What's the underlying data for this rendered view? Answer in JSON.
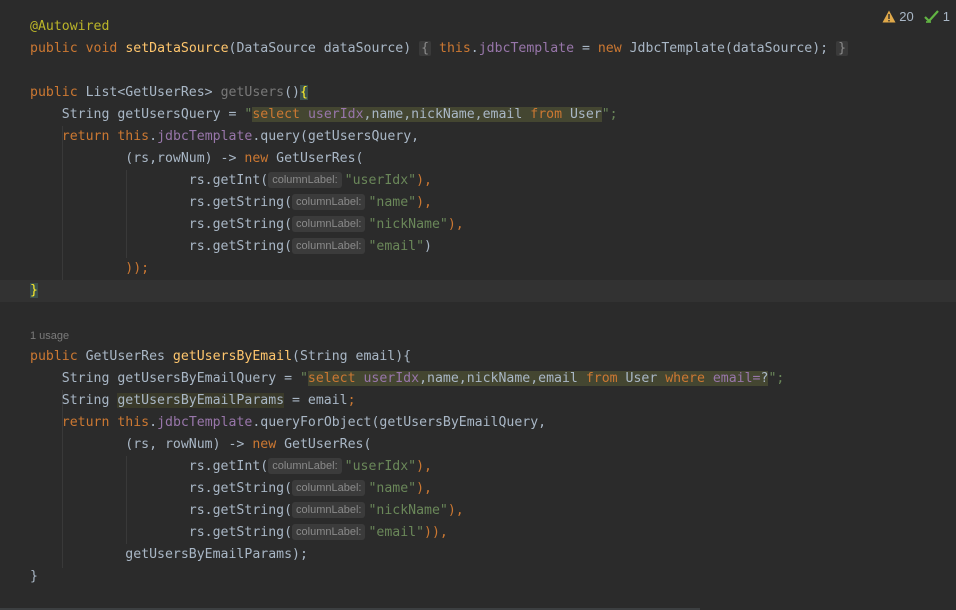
{
  "status": {
    "warnings_count": "20",
    "checks_count": "1",
    "warning_color": "#e0a94a",
    "check_color": "#62b543"
  },
  "code": {
    "annotation": "@Autowired",
    "usage_hint": "1 usage",
    "hint_label": "columnLabel:",
    "setDataSource": {
      "kw_public": "public",
      "kw_void": "void",
      "name": "setDataSource",
      "params": "(DataSource dataSource)",
      "fold_open": "{",
      "kw_this": "this",
      "field": "jdbcTemplate",
      "assign": " = ",
      "kw_new": "new",
      "ctor": " JdbcTemplate(dataSource);",
      "fold_close": "}"
    },
    "getUsers": {
      "sig_public": "public",
      "sig_type": " List<GetUserRes> ",
      "name": "getUsers",
      "paren": "()",
      "open_brace": "{",
      "q_decl": "String getUsersQuery = ",
      "q_open": "\"",
      "q_sql_select": "select",
      "q_sql_space": " ",
      "q_sql_cols": "userIdx",
      "q_sql_rest": ",name,nickName,email ",
      "q_sql_from": "from",
      "q_sql_table": " User",
      "q_close": "\";",
      "ret_kw": "return",
      "ret_this": "this",
      "ret_field": "jdbcTemplate",
      "ret_call": ".query(getUsersQuery,",
      "lambda_start": "(rs,rowNum) -> ",
      "lambda_new": "new",
      "lambda_type": " GetUserRes(",
      "rows": [
        {
          "call": "rs.getInt(",
          "str": "\"userIdx\"",
          "tail": "),"
        },
        {
          "call": "rs.getString(",
          "str": "\"name\"",
          "tail": "),"
        },
        {
          "call": "rs.getString(",
          "str": "\"nickName\"",
          "tail": "),"
        },
        {
          "call": "rs.getString(",
          "str": "\"email\"",
          "tail": ")"
        }
      ],
      "end_paren": "));",
      "close_brace": "}"
    },
    "getUsersByEmail": {
      "sig_public": "public",
      "sig_type": " GetUserRes ",
      "name": "getUsersByEmail",
      "params": "(String email){",
      "q_decl": "String getUsersByEmailQuery = ",
      "q_open": "\"",
      "q_sql_select": "select",
      "q_sql_cols": " userIdx",
      "q_sql_rest": ",name,nickName,email ",
      "q_sql_from": "from",
      "q_sql_table": " User ",
      "q_sql_where": "where",
      "q_sql_cond": " email=",
      "q_sql_q": "?",
      "q_close": "\";",
      "p_decl": "String ",
      "p_name": "getUsersByEmailParams",
      "p_assign": " = email",
      "p_semi": ";",
      "ret_kw": "return",
      "ret_this": "this",
      "ret_field": "jdbcTemplate",
      "ret_call": ".queryForObject(getUsersByEmailQuery,",
      "lambda_start": "(rs, rowNum) -> ",
      "lambda_new": "new",
      "lambda_type": " GetUserRes(",
      "rows": [
        {
          "call": "rs.getInt(",
          "str": "\"userIdx\"",
          "tail": "),"
        },
        {
          "call": "rs.getString(",
          "str": "\"name\"",
          "tail": "),"
        },
        {
          "call": "rs.getString(",
          "str": "\"nickName\"",
          "tail": "),"
        },
        {
          "call": "rs.getString(",
          "str": "\"email\"",
          "tail": ")),"
        }
      ],
      "end_params": "getUsersByEmailParams);",
      "close_brace": "}"
    }
  }
}
